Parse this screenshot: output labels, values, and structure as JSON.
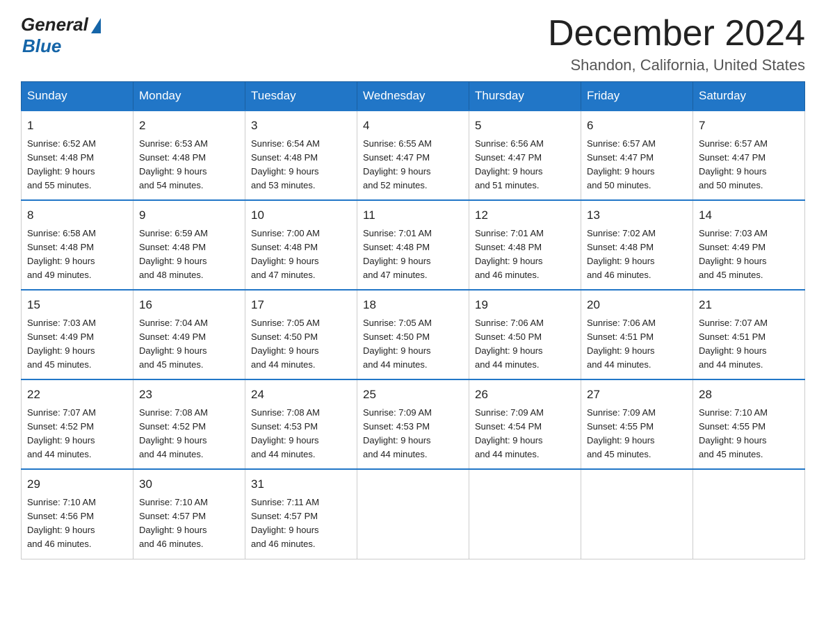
{
  "logo": {
    "text_general": "General",
    "text_blue": "Blue"
  },
  "title": {
    "month_year": "December 2024",
    "location": "Shandon, California, United States"
  },
  "days_of_week": [
    "Sunday",
    "Monday",
    "Tuesday",
    "Wednesday",
    "Thursday",
    "Friday",
    "Saturday"
  ],
  "weeks": [
    [
      {
        "day": "1",
        "sunrise": "6:52 AM",
        "sunset": "4:48 PM",
        "daylight": "9 hours and 55 minutes."
      },
      {
        "day": "2",
        "sunrise": "6:53 AM",
        "sunset": "4:48 PM",
        "daylight": "9 hours and 54 minutes."
      },
      {
        "day": "3",
        "sunrise": "6:54 AM",
        "sunset": "4:48 PM",
        "daylight": "9 hours and 53 minutes."
      },
      {
        "day": "4",
        "sunrise": "6:55 AM",
        "sunset": "4:47 PM",
        "daylight": "9 hours and 52 minutes."
      },
      {
        "day": "5",
        "sunrise": "6:56 AM",
        "sunset": "4:47 PM",
        "daylight": "9 hours and 51 minutes."
      },
      {
        "day": "6",
        "sunrise": "6:57 AM",
        "sunset": "4:47 PM",
        "daylight": "9 hours and 50 minutes."
      },
      {
        "day": "7",
        "sunrise": "6:57 AM",
        "sunset": "4:47 PM",
        "daylight": "9 hours and 50 minutes."
      }
    ],
    [
      {
        "day": "8",
        "sunrise": "6:58 AM",
        "sunset": "4:48 PM",
        "daylight": "9 hours and 49 minutes."
      },
      {
        "day": "9",
        "sunrise": "6:59 AM",
        "sunset": "4:48 PM",
        "daylight": "9 hours and 48 minutes."
      },
      {
        "day": "10",
        "sunrise": "7:00 AM",
        "sunset": "4:48 PM",
        "daylight": "9 hours and 47 minutes."
      },
      {
        "day": "11",
        "sunrise": "7:01 AM",
        "sunset": "4:48 PM",
        "daylight": "9 hours and 47 minutes."
      },
      {
        "day": "12",
        "sunrise": "7:01 AM",
        "sunset": "4:48 PM",
        "daylight": "9 hours and 46 minutes."
      },
      {
        "day": "13",
        "sunrise": "7:02 AM",
        "sunset": "4:48 PM",
        "daylight": "9 hours and 46 minutes."
      },
      {
        "day": "14",
        "sunrise": "7:03 AM",
        "sunset": "4:49 PM",
        "daylight": "9 hours and 45 minutes."
      }
    ],
    [
      {
        "day": "15",
        "sunrise": "7:03 AM",
        "sunset": "4:49 PM",
        "daylight": "9 hours and 45 minutes."
      },
      {
        "day": "16",
        "sunrise": "7:04 AM",
        "sunset": "4:49 PM",
        "daylight": "9 hours and 45 minutes."
      },
      {
        "day": "17",
        "sunrise": "7:05 AM",
        "sunset": "4:50 PM",
        "daylight": "9 hours and 44 minutes."
      },
      {
        "day": "18",
        "sunrise": "7:05 AM",
        "sunset": "4:50 PM",
        "daylight": "9 hours and 44 minutes."
      },
      {
        "day": "19",
        "sunrise": "7:06 AM",
        "sunset": "4:50 PM",
        "daylight": "9 hours and 44 minutes."
      },
      {
        "day": "20",
        "sunrise": "7:06 AM",
        "sunset": "4:51 PM",
        "daylight": "9 hours and 44 minutes."
      },
      {
        "day": "21",
        "sunrise": "7:07 AM",
        "sunset": "4:51 PM",
        "daylight": "9 hours and 44 minutes."
      }
    ],
    [
      {
        "day": "22",
        "sunrise": "7:07 AM",
        "sunset": "4:52 PM",
        "daylight": "9 hours and 44 minutes."
      },
      {
        "day": "23",
        "sunrise": "7:08 AM",
        "sunset": "4:52 PM",
        "daylight": "9 hours and 44 minutes."
      },
      {
        "day": "24",
        "sunrise": "7:08 AM",
        "sunset": "4:53 PM",
        "daylight": "9 hours and 44 minutes."
      },
      {
        "day": "25",
        "sunrise": "7:09 AM",
        "sunset": "4:53 PM",
        "daylight": "9 hours and 44 minutes."
      },
      {
        "day": "26",
        "sunrise": "7:09 AM",
        "sunset": "4:54 PM",
        "daylight": "9 hours and 44 minutes."
      },
      {
        "day": "27",
        "sunrise": "7:09 AM",
        "sunset": "4:55 PM",
        "daylight": "9 hours and 45 minutes."
      },
      {
        "day": "28",
        "sunrise": "7:10 AM",
        "sunset": "4:55 PM",
        "daylight": "9 hours and 45 minutes."
      }
    ],
    [
      {
        "day": "29",
        "sunrise": "7:10 AM",
        "sunset": "4:56 PM",
        "daylight": "9 hours and 46 minutes."
      },
      {
        "day": "30",
        "sunrise": "7:10 AM",
        "sunset": "4:57 PM",
        "daylight": "9 hours and 46 minutes."
      },
      {
        "day": "31",
        "sunrise": "7:11 AM",
        "sunset": "4:57 PM",
        "daylight": "9 hours and 46 minutes."
      },
      null,
      null,
      null,
      null
    ]
  ],
  "labels": {
    "sunrise": "Sunrise:",
    "sunset": "Sunset:",
    "daylight": "Daylight:"
  }
}
